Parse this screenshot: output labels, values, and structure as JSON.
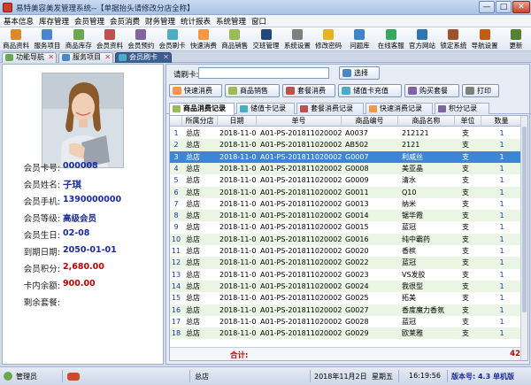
{
  "window": {
    "title": "易特美容美发管理系统--【单据抬头请修改分店全称】",
    "min": "—",
    "max": "□",
    "close": "✕"
  },
  "menu": [
    "基本信息",
    "库存管理",
    "会员管理",
    "会员消费",
    "财务管理",
    "统计报表",
    "系统管理",
    "窗口"
  ],
  "toolbar": [
    {
      "label": "商品资料",
      "icon": "box-icon",
      "color": "#d98b2a"
    },
    {
      "label": "服务项目",
      "icon": "scissors-icon",
      "color": "#4a86c8"
    },
    {
      "label": "商品库存",
      "icon": "warehouse-icon",
      "color": "#6aa84f"
    },
    {
      "label": "会员资料",
      "icon": "member-icon",
      "color": "#c0504d"
    },
    {
      "label": "会员预约",
      "icon": "calendar-icon",
      "color": "#8064a2"
    },
    {
      "label": "会员刷卡",
      "icon": "card-icon",
      "color": "#4bacc6"
    },
    {
      "label": "快速消费",
      "icon": "cart-icon",
      "color": "#f79646"
    },
    {
      "label": "商品销售",
      "icon": "sale-icon",
      "color": "#9bbb59"
    },
    {
      "label": "交班管理",
      "icon": "shift-icon",
      "color": "#1f497d"
    },
    {
      "label": "系统设置",
      "icon": "gear-icon",
      "color": "#7f7f7f"
    },
    {
      "label": "修改密码",
      "icon": "key-icon",
      "color": "#e6b422"
    },
    {
      "label": "问题库",
      "icon": "question-icon",
      "color": "#3d85c6"
    },
    {
      "label": "在线客服",
      "icon": "chat-icon",
      "color": "#38a85b"
    },
    {
      "label": "官方网站",
      "icon": "globe-icon",
      "color": "#2e75b6"
    },
    {
      "label": "锁定系统",
      "icon": "lock-icon",
      "color": "#a0522d"
    },
    {
      "label": "导航设置",
      "icon": "nav-icon",
      "color": "#c55a11"
    },
    {
      "label": "更新",
      "icon": "update-icon",
      "color": "#548235"
    }
  ],
  "tabs": [
    {
      "label": "功能导航",
      "icon": "nav-icon",
      "close": "✕"
    },
    {
      "label": "服务项目",
      "icon": "scissors-icon",
      "close": "✕"
    },
    {
      "label": "会员刷卡",
      "icon": "card-icon",
      "close": "✕"
    }
  ],
  "member": {
    "fields": [
      {
        "label": "会员卡号:",
        "value": "000008"
      },
      {
        "label": "会员姓名:",
        "value": "子琪"
      },
      {
        "label": "会员手机:",
        "value": "1390000000"
      },
      {
        "label": "会员等级:",
        "value": "高级会员"
      },
      {
        "label": "会员生日:",
        "value": "02-08"
      },
      {
        "label": "到期日期:",
        "value": "2050-01-01"
      },
      {
        "label": "会员积分:",
        "value": "2,680.00"
      },
      {
        "label": "卡内余额:",
        "value": "900.00"
      },
      {
        "label": "剩余套餐:",
        "value": ""
      }
    ]
  },
  "swipe": {
    "label": "请刷卡:",
    "value": "",
    "select_btn": "选择",
    "buttons": [
      "快速消费",
      "商品销售",
      "套餐消费",
      "储值卡充值",
      "购买套餐",
      "打印"
    ]
  },
  "subtabs": [
    "商品消费记录",
    "储值卡记录",
    "套餐消费记录",
    "快速消费记录",
    "积分记录"
  ],
  "chart_data": {
    "type": "table",
    "columns": [
      "",
      "所属分店",
      "日期",
      "单号",
      "商品编号",
      "商品名称",
      "单位",
      "数量"
    ],
    "rows": [
      [
        "1",
        "总店",
        "2018-11-02",
        "A01-PS-201811020002",
        "A0037",
        "212121",
        "支",
        "1"
      ],
      [
        "2",
        "总店",
        "2018-11-02",
        "A01-PS-201811020002",
        "AB502",
        "2121",
        "支",
        "1"
      ],
      [
        "3",
        "总店",
        "2018-11-02",
        "A01-PS-201811020002",
        "G0007",
        "利威丝",
        "支",
        "1"
      ],
      [
        "4",
        "总店",
        "2018-11-02",
        "A01-PS-201811020002",
        "G0008",
        "美亚晶",
        "支",
        "1"
      ],
      [
        "5",
        "总店",
        "2018-11-02",
        "A01-PS-201811020002",
        "G0009",
        "清水",
        "支",
        "1"
      ],
      [
        "6",
        "总店",
        "2018-11-02",
        "A01-PS-201811020002",
        "G0011",
        "Q10",
        "支",
        "1"
      ],
      [
        "7",
        "总店",
        "2018-11-02",
        "A01-PS-201811020002",
        "G0013",
        "纳米",
        "支",
        "1"
      ],
      [
        "8",
        "总店",
        "2018-11-02",
        "A01-PS-201811020002",
        "G0014",
        "锯华霞",
        "支",
        "1"
      ],
      [
        "9",
        "总店",
        "2018-11-02",
        "A01-PS-201811020002",
        "G0015",
        "蓝冠",
        "支",
        "1"
      ],
      [
        "10",
        "总店",
        "2018-11-02",
        "A01-PS-201811020002",
        "G0016",
        "纯中霸药",
        "支",
        "1"
      ],
      [
        "11",
        "总店",
        "2018-11-02",
        "A01-PS-201811020002",
        "G0020",
        "香槟",
        "支",
        "1"
      ],
      [
        "12",
        "总店",
        "2018-11-02",
        "A01-PS-201811020002",
        "G0022",
        "蓝冠",
        "支",
        "1"
      ],
      [
        "13",
        "总店",
        "2018-11-02",
        "A01-PS-201811020002",
        "G0023",
        "VS发胶",
        "支",
        "1"
      ],
      [
        "14",
        "总店",
        "2018-11-02",
        "A01-PS-201811020002",
        "G0024",
        "我很型",
        "支",
        "1"
      ],
      [
        "15",
        "总店",
        "2018-11-02",
        "A01-PS-201811020002",
        "G0025",
        "拓美",
        "支",
        "1"
      ],
      [
        "16",
        "总店",
        "2018-11-02",
        "A01-PS-201811020002",
        "G0027",
        "香度魔力香氛",
        "支",
        "1"
      ],
      [
        "17",
        "总店",
        "2018-11-02",
        "A01-PS-201811020002",
        "G0028",
        "蓝冠",
        "支",
        "1"
      ],
      [
        "18",
        "总店",
        "2018-11-02",
        "A01-PS-201811020002",
        "G0029",
        "欧莱雅",
        "支",
        "1"
      ]
    ],
    "selected_row": 3,
    "footer_label": "合计:",
    "footer_total": "42"
  },
  "status": {
    "user": "管理员",
    "store": "总店",
    "date": "2018年11月2日",
    "weekday": "星期五",
    "time": "16:19:56",
    "version": "版本号: 4.3 单机版"
  }
}
